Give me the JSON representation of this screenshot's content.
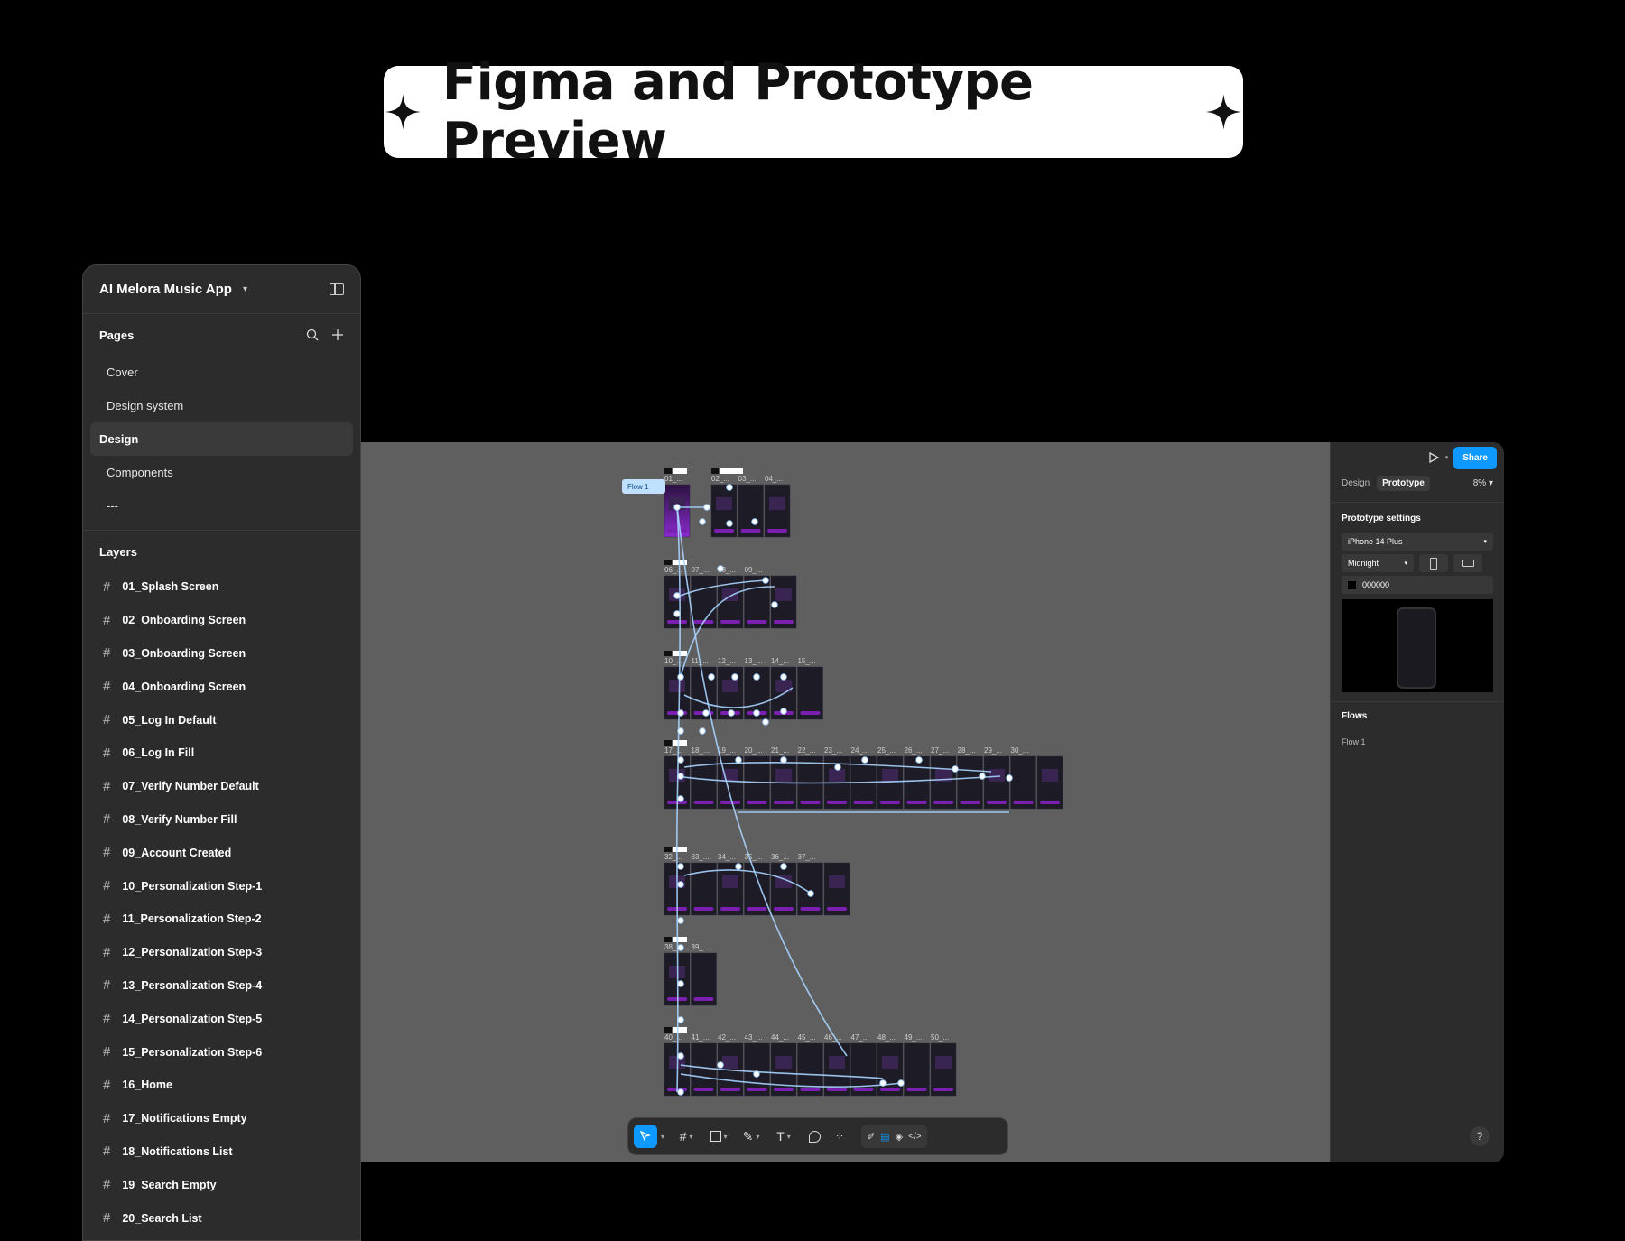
{
  "hero": {
    "title": "Figma and Prototype Preview"
  },
  "left": {
    "app_name": "AI Melora Music App",
    "pages_title": "Pages",
    "pages": [
      "Cover",
      "Design system",
      "Design",
      "Components",
      "---"
    ],
    "selected_page": "Design",
    "layers_title": "Layers",
    "layers": [
      "01_Splash Screen",
      "02_Onboarding Screen",
      "03_Onboarding Screen",
      "04_Onboarding Screen",
      "05_Log In Default",
      "06_Log In Fill",
      "07_Verify Number Default",
      "08_Verify Number Fill",
      "09_Account Created",
      "10_Personalization Step-1",
      "11_Personalization Step-2",
      "12_Personalization Step-3",
      "13_Personalization Step-4",
      "14_Personalization Step-5",
      "15_Personalization Step-6",
      "16_Home",
      "17_Notifications Empty",
      "18_Notifications List",
      "19_Search Empty",
      "20_Search List"
    ]
  },
  "canvas": {
    "flow_label": "Flow 1",
    "rows": [
      {
        "labels": [
          "01_..."
        ],
        "frames": 1
      },
      {
        "labels": [
          "02_...",
          "03_...",
          "04_..."
        ],
        "frames": 3
      },
      {
        "labels": [
          "06_...",
          "07_...",
          "08_...",
          "09_..."
        ],
        "frames": 5
      },
      {
        "labels": [
          "10_...",
          "11_...",
          "12_...",
          "13_...",
          "14_...",
          "15_..."
        ],
        "frames": 6
      },
      {
        "labels": [
          "17_...",
          "18_...",
          "19_...",
          "20_...",
          "21_...",
          "22_...",
          "23_...",
          "24_...",
          "25_...",
          "26_...",
          "27_...",
          "28_...",
          "29_...",
          "30_..."
        ],
        "frames": 15
      },
      {
        "labels": [
          "32_...",
          "33_...",
          "34_...",
          "35_...",
          "36_...",
          "37_..."
        ],
        "frames": 7
      },
      {
        "labels": [
          "38_...",
          "39_..."
        ],
        "frames": 2
      },
      {
        "labels": [
          "40_...",
          "41_...",
          "42_...",
          "43_...",
          "44_...",
          "45_...",
          "46_...",
          "47_...",
          "48_...",
          "49_...",
          "50_..."
        ],
        "frames": 11
      }
    ]
  },
  "right": {
    "share": "Share",
    "tab_design": "Design",
    "tab_prototype": "Prototype",
    "zoom": "8%",
    "settings_title": "Prototype settings",
    "device": "iPhone 14 Plus",
    "model": "Midnight",
    "bg_color": "000000",
    "flows_title": "Flows",
    "flows": [
      "Flow 1"
    ]
  },
  "colors": {
    "accent": "#0d99ff",
    "canvas": "#5f5f5f",
    "panel": "#2c2c2c",
    "connector": "#a8d4ff",
    "frame_purple": "#7a1fb0"
  },
  "toolbar": [
    "move-icon",
    "frame-icon",
    "rectangle-icon",
    "pen-icon",
    "text-icon",
    "comment-icon",
    "components-icon",
    "draw-icon",
    "dev-mode-icon",
    "prototype-icon",
    "code-icon"
  ]
}
